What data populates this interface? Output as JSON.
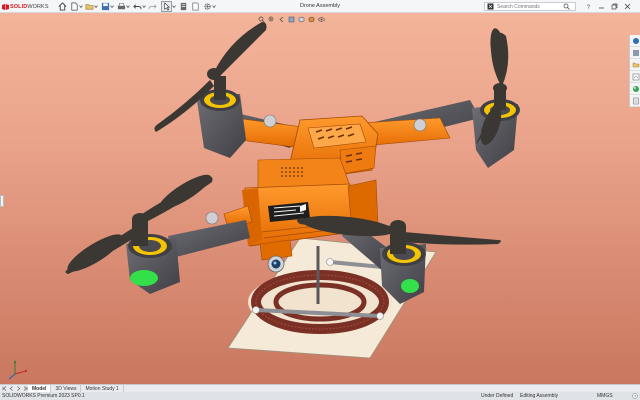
{
  "app": {
    "logo_brand": "SOLID",
    "logo_suffix": "WORKS",
    "document_title": "Drone Assembly"
  },
  "toolbar": {
    "icons": [
      "home-icon",
      "new-document-icon",
      "open-folder-icon",
      "save-icon",
      "print-icon",
      "undo-icon",
      "redo-icon",
      "select-cursor-icon",
      "rebuild-icon",
      "file-properties-icon",
      "options-gear-icon"
    ]
  },
  "search": {
    "placeholder": "Search Commands"
  },
  "tabs": [
    {
      "label": "Model",
      "active": true
    },
    {
      "label": "3D Views",
      "active": false
    },
    {
      "label": "Motion Study 1",
      "active": false
    }
  ],
  "status": {
    "product": "SOLIDWORKS Premium 2023 SP0.1",
    "definition": "Under Defined",
    "mode": "Editing Assembly",
    "units": "MMGS"
  },
  "colors": {
    "body_orange": "#f07a12",
    "propeller": "#3b3834",
    "motor_gray": "#5e5e63",
    "motor_ring_yellow": "#f5c400",
    "led_green": "#33e04a",
    "pad_coil": "#7a3025",
    "background_top": "#f3b49a",
    "background_bottom": "#c9785f",
    "brand_red": "#d71920"
  }
}
